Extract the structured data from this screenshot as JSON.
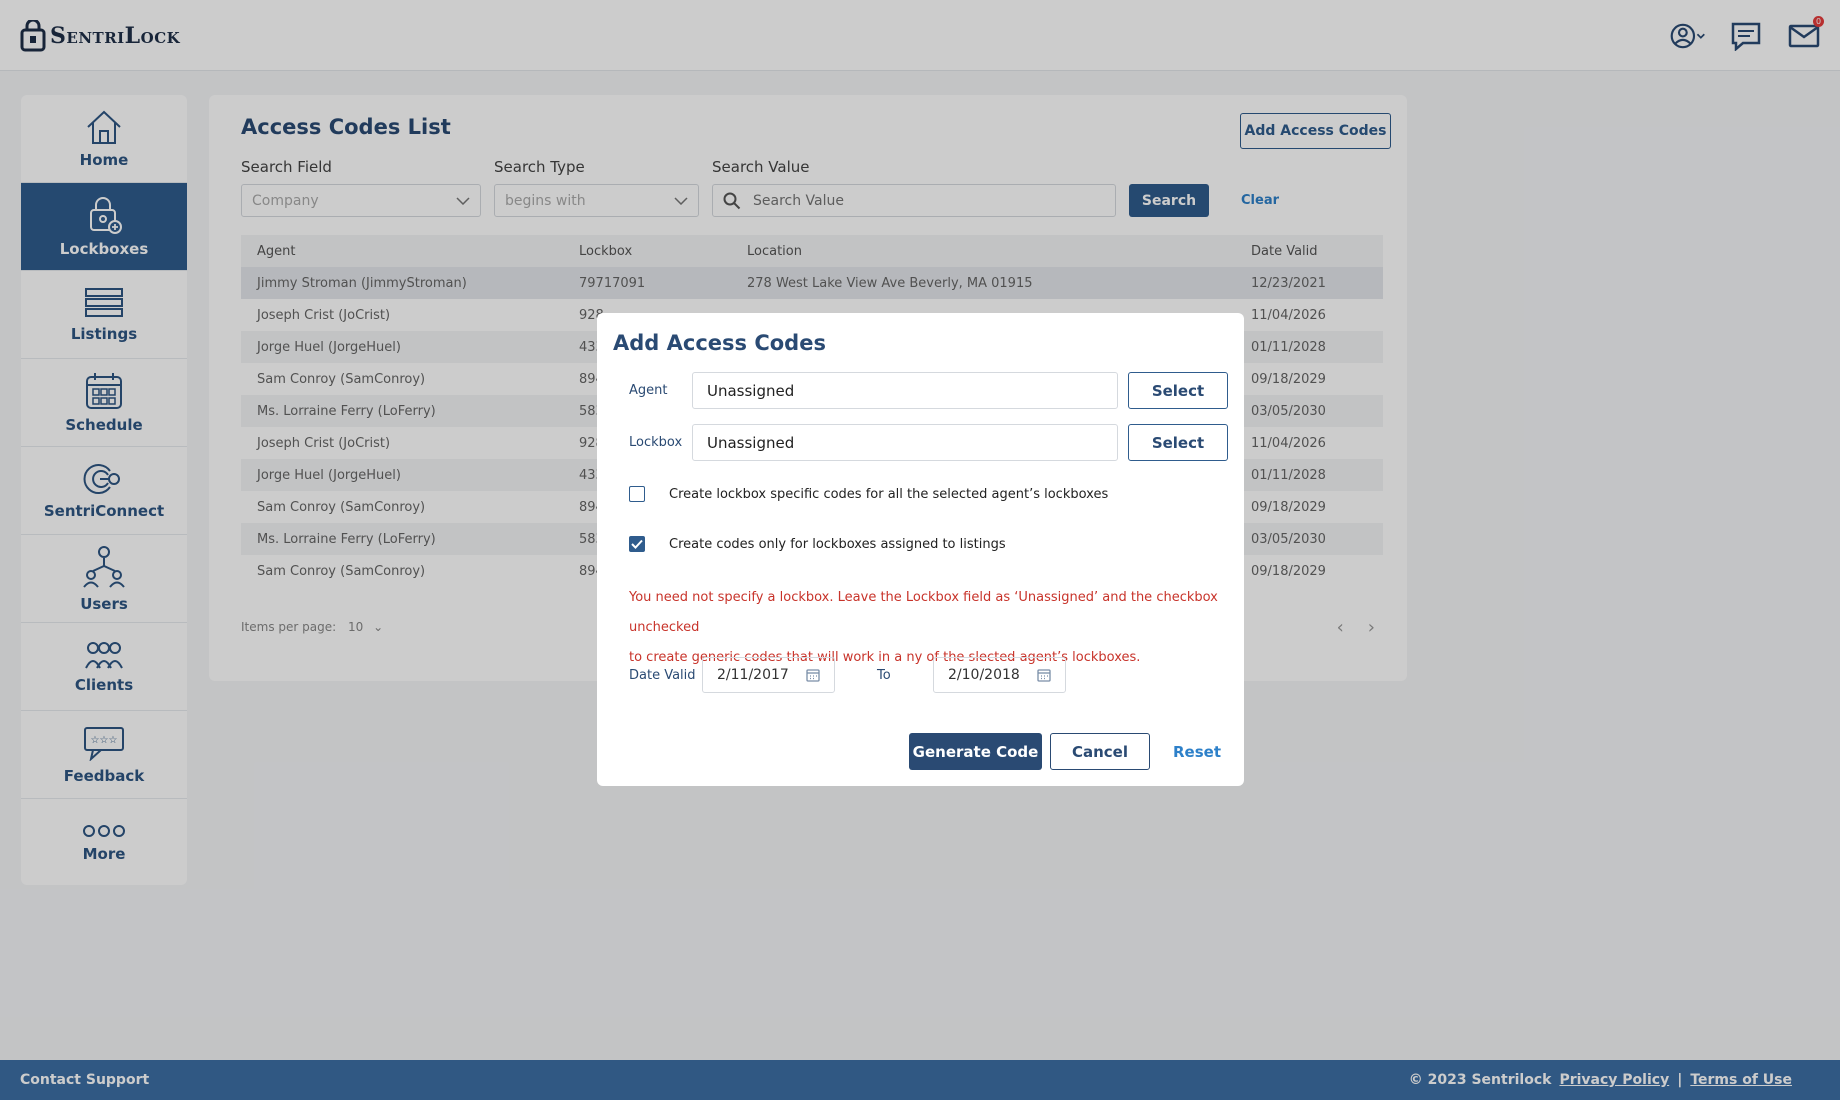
{
  "brand": {
    "logo_text": "SentriLock",
    "accent": "#2f5c8d",
    "footer_color": "#3d6fa4",
    "error_color": "#c8332a"
  },
  "topbar": {
    "icons": [
      "user-circle-icon",
      "chat-icon",
      "mail-icon"
    ],
    "mail_badge": "0"
  },
  "sidebar": {
    "items": [
      {
        "label": "Home",
        "icon": "home-icon"
      },
      {
        "label": "Lockboxes",
        "icon": "lockbox-icon",
        "active": true
      },
      {
        "label": "Listings",
        "icon": "listings-icon"
      },
      {
        "label": "Schedule",
        "icon": "calendar-icon"
      },
      {
        "label": "SentriConnect",
        "icon": "sentriconnect-icon"
      },
      {
        "label": "Users",
        "icon": "users-icon"
      },
      {
        "label": "Clients",
        "icon": "clients-icon"
      },
      {
        "label": "Feedback",
        "icon": "feedback-icon"
      },
      {
        "label": "More",
        "icon": "more-icon"
      }
    ]
  },
  "main": {
    "title": "Access Codes List",
    "add_button": "Add Access Codes",
    "search_field_label": "Search Field",
    "search_field_value": "Company",
    "search_type_label": "Search Type",
    "search_type_value": "begins with",
    "search_value_label": "Search Value",
    "search_value_placeholder": "Search Value",
    "search_button": "Search",
    "clear_link": "Clear",
    "table": {
      "headers": [
        "Agent",
        "Lockbox",
        "Location",
        "Date Valid"
      ],
      "rows": [
        [
          "Jimmy Stroman (JimmyStroman)",
          "79717091",
          "278 West Lake View Ave Beverly, MA 01915",
          "12/23/2021"
        ],
        [
          "Joseph Crist (JoCrist)",
          "928",
          "",
          "11/04/2026"
        ],
        [
          "Jorge Huel (JorgeHuel)",
          "433",
          "",
          "01/11/2028"
        ],
        [
          "Sam Conroy (SamConroy)",
          "894",
          "",
          "09/18/2029"
        ],
        [
          "Ms. Lorraine Ferry (LoFerry)",
          "583",
          "",
          "03/05/2030"
        ],
        [
          "Joseph Crist (JoCrist)",
          "928",
          "",
          "11/04/2026"
        ],
        [
          "Jorge Huel (JorgeHuel)",
          "433",
          "",
          "01/11/2028"
        ],
        [
          "Sam Conroy (SamConroy)",
          "894",
          "",
          "09/18/2029"
        ],
        [
          "Ms. Lorraine Ferry (LoFerry)",
          "583",
          "",
          "03/05/2030"
        ],
        [
          "Sam Conroy (SamConroy)",
          "894",
          "",
          "09/18/2029"
        ]
      ]
    },
    "items_per_page_label": "Items per page:",
    "items_per_page_value": "10"
  },
  "modal": {
    "title": "Add Access Codes",
    "agent_label": "Agent",
    "agent_value": "Unassigned",
    "lockbox_label": "Lockbox",
    "lockbox_value": "Unassigned",
    "select_label": "Select",
    "checkbox1_label": "Create lockbox specific codes for all the selected agent’s lockboxes",
    "checkbox1_checked": false,
    "checkbox2_label": "Create codes only for lockboxes assigned to listings",
    "checkbox2_checked": true,
    "warning_line1": "You need not specify a lockbox. Leave the Lockbox field as ‘Unassigned’ and the checkbox unchecked",
    "warning_line2": " to create generic codes that will work in a ny of the slected agent’s lockboxes.",
    "date_valid_label": "Date Valid",
    "date_from": "2/11/2017",
    "to_label": "To",
    "date_to": "2/10/2018",
    "generate_button": "Generate Code",
    "cancel_button": "Cancel",
    "reset_link": "Reset"
  },
  "footer": {
    "contact_support": "Contact Support",
    "copyright": "© 2023 Sentrilock",
    "privacy": "Privacy Policy",
    "separator": "|",
    "terms": "Terms of Use"
  }
}
